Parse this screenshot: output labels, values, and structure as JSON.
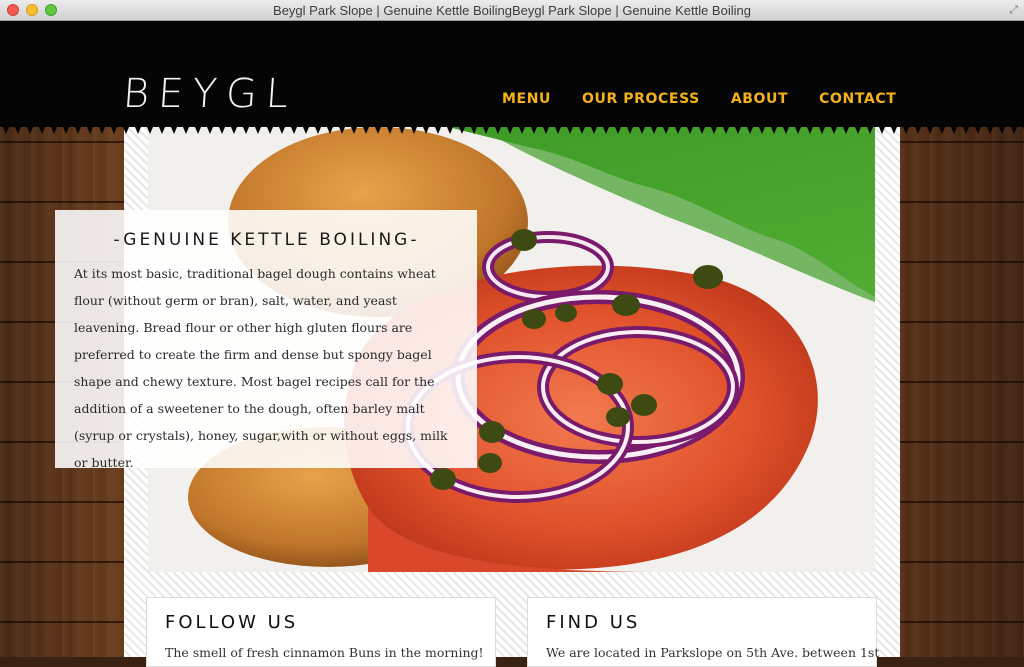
{
  "window": {
    "title": "Beygl Park Slope | Genuine Kettle BoilingBeygl Park Slope | Genuine Kettle Boiling"
  },
  "header": {
    "logo": "BEYGL",
    "nav": [
      {
        "label": "MENU"
      },
      {
        "label": "OUR PROCESS"
      },
      {
        "label": "ABOUT"
      },
      {
        "label": "CONTACT"
      }
    ]
  },
  "hero": {
    "heading": "-GENUINE KETTLE BOILING-",
    "body": "At its most basic, traditional bagel dough contains wheat flour (without germ or bran), salt, water, and yeast leavening. Bread flour or other high gluten flours are preferred to create the firm and dense but spongy bagel shape and chewy texture. Most bagel recipes call for the addition of a sweetener to the dough, often barley malt (syrup or crystals), honey, sugar,with or without eggs, milk or butter."
  },
  "cards": [
    {
      "title": "FOLLOW US",
      "text": "The smell of fresh cinnamon Buns in the morning!"
    },
    {
      "title": "FIND US",
      "text": "We are located in Parkslope on 5th Ave. between 1st"
    }
  ],
  "colors": {
    "nav": "#f5b21a",
    "header": "#050505"
  }
}
